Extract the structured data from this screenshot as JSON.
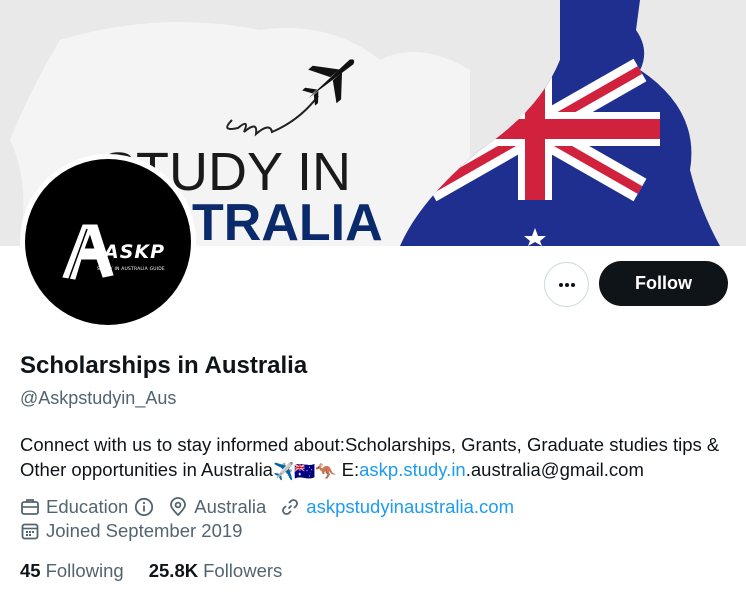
{
  "banner": {
    "headline_line1": "STUDY IN",
    "headline_line2": "TRALIA"
  },
  "avatar": {
    "logo_letter": "A",
    "logo_text": "ASKP",
    "logo_subtext": "STUDY IN AUSTRALIA GUIDE"
  },
  "actions": {
    "more_icon": "ellipsis-icon",
    "follow_label": "Follow"
  },
  "profile": {
    "name": "Scholarships in Australia",
    "handle": "@Askpstudyin_Aus",
    "bio_text": "Connect with us to stay informed about:Scholarships, Grants, Graduate studies tips & Other opportunities in Australia",
    "bio_emojis": "✈️🇦🇺🦘",
    "bio_email_prefix": " E:",
    "bio_email_link": "askp.study.in",
    "bio_email_suffix": ".australia@gmail.com",
    "category": "Education",
    "location": "Australia",
    "website": "askpstudyinaustralia.com",
    "joined": "Joined September 2019"
  },
  "stats": {
    "following_count": "45",
    "following_label": "Following",
    "followers_count": "25.8K",
    "followers_label": "Followers"
  },
  "colors": {
    "accent": "#1d9bf0",
    "text_primary": "#0f1419",
    "text_secondary": "#536471",
    "follow_bg": "#0f1419"
  }
}
